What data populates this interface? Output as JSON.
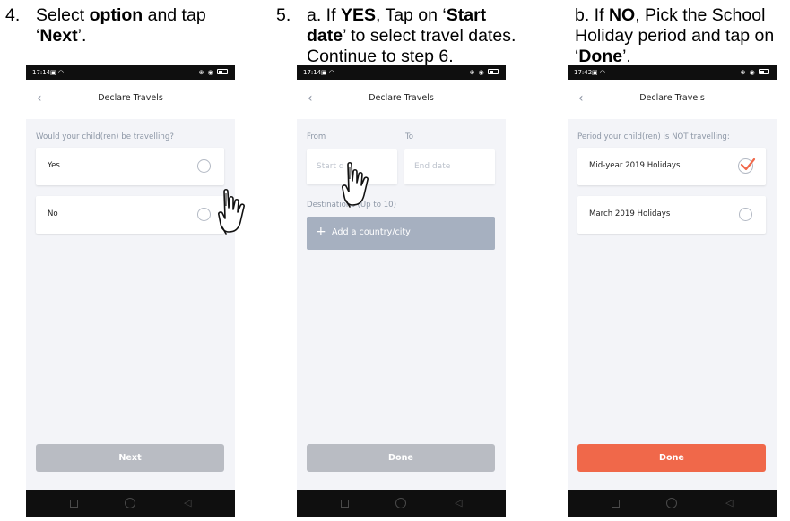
{
  "steps": [
    {
      "number": "4.",
      "before": "Select ",
      "b1": "option",
      "middle": " and tap",
      "line2_before": "‘",
      "b2": "Next",
      "line2_after": "’."
    },
    {
      "number": "5.",
      "line1_before": "a. If ",
      "b1": "YES",
      "line1_mid": ", Tap on ‘",
      "b2": "Start",
      "b3": "date",
      "line2_after": "’ to select travel dates.",
      "line3": "Continue to step 6."
    },
    {
      "line1_before": "b. If ",
      "b1": "NO",
      "line1_after": ", Pick the School",
      "line2": "Holiday period and tap on",
      "line3_before": "‘",
      "b2": "Done",
      "line3_after": "’."
    }
  ],
  "screens": [
    {
      "status_time": "17:14",
      "header_title": "Declare Travels",
      "question": "Would your child(ren) be travelling?",
      "options": [
        {
          "label": "Yes"
        },
        {
          "label": "No"
        }
      ],
      "button": "Next"
    },
    {
      "status_time": "17:14",
      "header_title": "Declare Travels",
      "from_label": "From",
      "to_label": "To",
      "start_placeholder": "Start d",
      "end_placeholder": "End date",
      "destinations_label": "Destinations (Up to 10)",
      "add_button": "Add a country/city",
      "button": "Done"
    },
    {
      "status_time": "17:42",
      "header_title": "Declare Travels",
      "question": "Period your child(ren) is NOT travelling:",
      "options": [
        {
          "label": "Mid-year 2019 Holidays",
          "checked": true
        },
        {
          "label": "March 2019 Holidays",
          "checked": false
        }
      ],
      "button": "Done"
    }
  ],
  "colors": {
    "accent_orange": "#f0684a",
    "disabled_grey": "#b9bcc3",
    "add_button": "#a6b0c0",
    "screen_bg": "#f3f4f8"
  },
  "icons": {
    "back": "chevron-left-icon",
    "hand": "pointing-hand-icon",
    "check": "checkmark-icon"
  }
}
